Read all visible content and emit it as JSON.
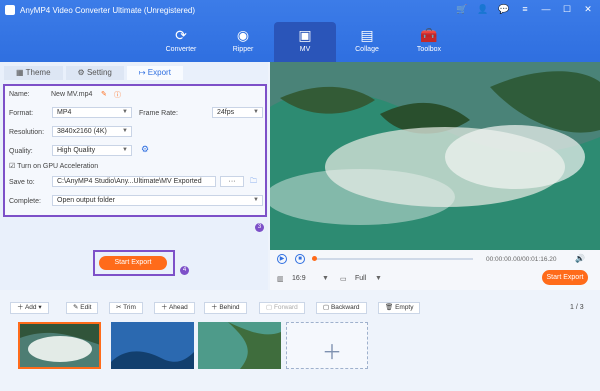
{
  "app": {
    "title": "AnyMP4 Video Converter Ultimate (Unregistered)"
  },
  "nav": [
    {
      "label": "Converter"
    },
    {
      "label": "Ripper"
    },
    {
      "label": "MV"
    },
    {
      "label": "Collage"
    },
    {
      "label": "Toolbox"
    }
  ],
  "tabs": [
    {
      "label": "Theme"
    },
    {
      "label": "Setting"
    },
    {
      "label": "Export"
    }
  ],
  "settings": {
    "name_label": "Name:",
    "name_value": "New MV.mp4",
    "format_label": "Format:",
    "format_value": "MP4",
    "frame_rate_label": "Frame Rate:",
    "frame_rate_value": "24fps",
    "resolution_label": "Resolution:",
    "resolution_value": "3840x2160 (4K)",
    "quality_label": "Quality:",
    "quality_value": "High Quality",
    "gpu_label": "Turn on GPU Acceleration",
    "save_label": "Save to:",
    "save_value": "C:\\AnyMP4 Studio\\Any...Ultimate\\MV Exported",
    "complete_label": "Complete:",
    "complete_value": "Open output folder",
    "step_badge_1": "3",
    "step_badge_2": "4"
  },
  "export": {
    "button_label": "Start Export"
  },
  "player": {
    "time": "00:00:00.00/00:01:16.20",
    "ratio": "16:9",
    "full": "Full",
    "start_export": "Start Export"
  },
  "tools": [
    {
      "label": "Add"
    },
    {
      "label": "Edit"
    },
    {
      "label": "Trim"
    },
    {
      "label": "Ahead"
    },
    {
      "label": "Behind"
    },
    {
      "label": "Forward"
    },
    {
      "label": "Backward"
    },
    {
      "label": "Empty"
    }
  ],
  "page": {
    "counter": "1 / 3"
  },
  "colors": {
    "accent": "#2F6FE0",
    "export": "#FF6B1A",
    "highlight": "#7D50C8"
  }
}
